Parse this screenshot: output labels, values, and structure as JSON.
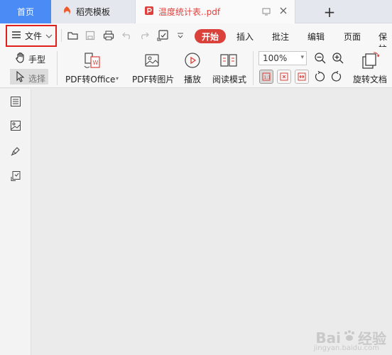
{
  "tabs": {
    "home": "首页",
    "template": "稻壳模板",
    "document": "温度统计表..pdf",
    "add": "+"
  },
  "toolbar": {
    "file_menu": "文件",
    "start": "开始",
    "insert": "插入",
    "comment": "批注",
    "edit": "编辑",
    "page": "页面",
    "protect": "保护"
  },
  "tools": {
    "hand": "手型",
    "select": "选择",
    "pdf_to_office": "PDF转Office",
    "pdf_to_image": "PDF转图片",
    "play": "播放",
    "read_mode": "阅读模式",
    "zoom": "100%",
    "rotate": "旋转文档"
  },
  "watermark": {
    "brand": "Bai",
    "suffix": "经验",
    "url": "jingyan.baidu.com"
  },
  "colors": {
    "accent_blue": "#4a8bf5",
    "accent_red": "#d9413a",
    "highlight_red": "#e0201c"
  }
}
